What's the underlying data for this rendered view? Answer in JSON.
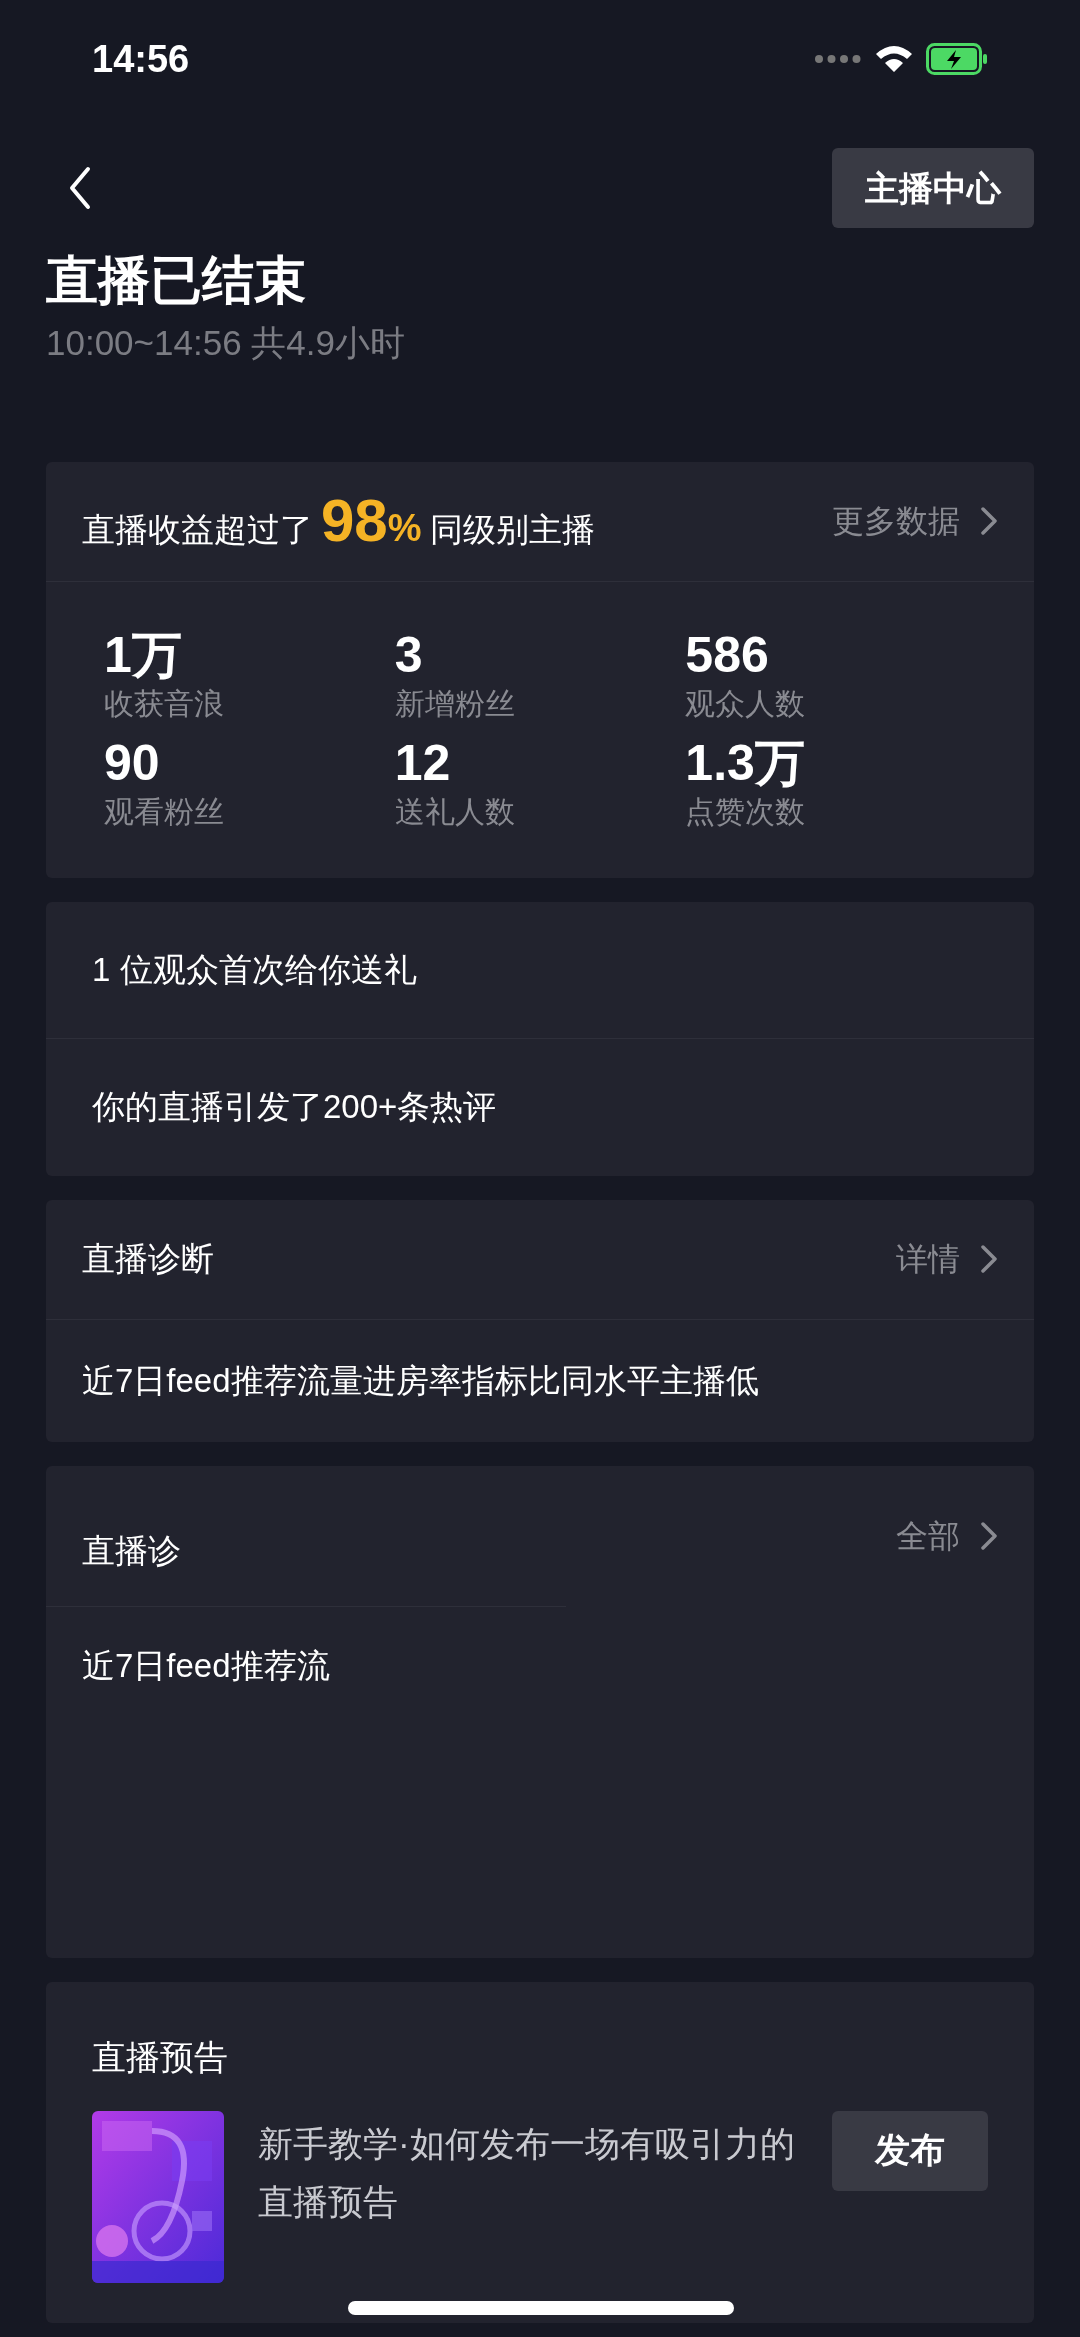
{
  "status_bar": {
    "time": "14:56"
  },
  "header": {
    "center_button": "主播中心",
    "title": "直播已结束",
    "subtitle": "10:00~14:56 共4.9小时"
  },
  "summary": {
    "prefix": "直播收益超过了",
    "percent": "98",
    "percent_sign": "%",
    "suffix": "同级别主播",
    "link": "更多数据",
    "stats": [
      {
        "value": "1万",
        "label": "收获音浪"
      },
      {
        "value": "3",
        "label": "新增粉丝"
      },
      {
        "value": "586",
        "label": "观众人数"
      },
      {
        "value": "90",
        "label": "观看粉丝"
      },
      {
        "value": "12",
        "label": "送礼人数"
      },
      {
        "value": "1.3万",
        "label": "点赞次数"
      }
    ]
  },
  "highlights": [
    "1 位观众首次给你送礼",
    "你的直播引发了200+条热评"
  ],
  "diagnosis": {
    "title": "直播诊断",
    "link": "详情",
    "text": "近7日feed推荐流量进房率指标比同水平主播低"
  },
  "partial_card": {
    "title": "直播诊",
    "link": "全部",
    "text": "近7日feed推荐流"
  },
  "preview": {
    "title": "直播预告",
    "text": "新手教学·如何发布一场有吸引力的直播预告",
    "button": "发布"
  }
}
